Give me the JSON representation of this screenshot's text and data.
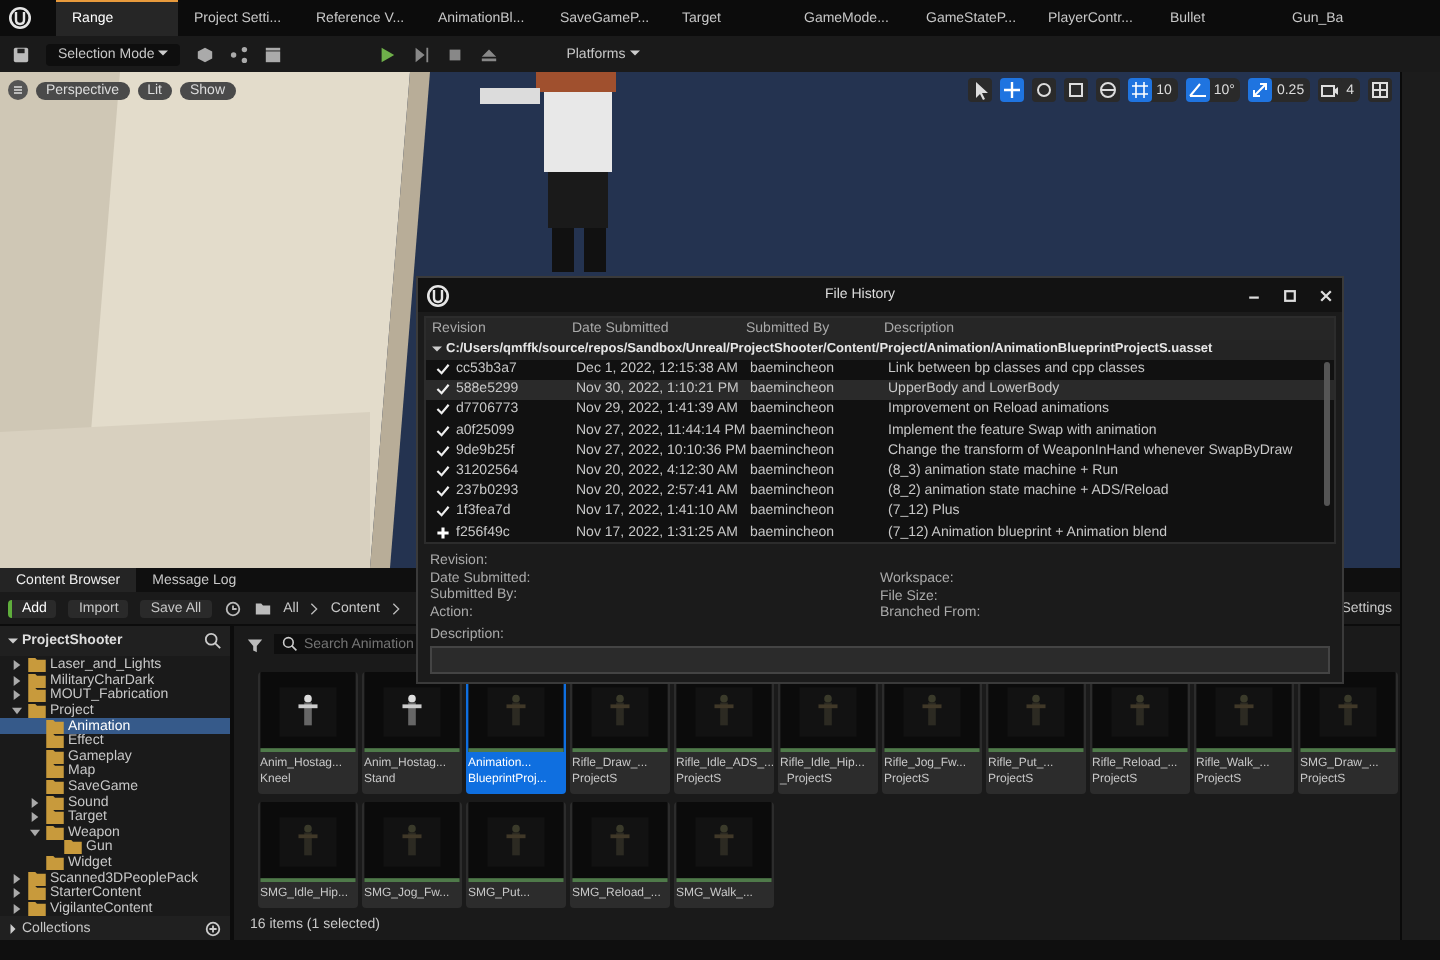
{
  "editor_tabs": [
    {
      "label": "Range",
      "selected": true
    },
    {
      "label": "Project Setti...",
      "selected": false
    },
    {
      "label": "Reference V...",
      "selected": false
    },
    {
      "label": "AnimationBl...",
      "selected": false
    },
    {
      "label": "SaveGameP...",
      "selected": false
    },
    {
      "label": "Target",
      "selected": false
    },
    {
      "label": "GameMode...",
      "selected": false
    },
    {
      "label": "GameStateP...",
      "selected": false
    },
    {
      "label": "PlayerContr...",
      "selected": false
    },
    {
      "label": "Bullet",
      "selected": false
    },
    {
      "label": "Gun_Ba",
      "selected": false
    }
  ],
  "toolbar": {
    "mode": "Selection Mode",
    "platforms": "Platforms"
  },
  "viewport": {
    "view_buttons": [
      "Perspective",
      "Lit",
      "Show"
    ],
    "grid_snap": "10",
    "rotation_snap": "10°",
    "scale_snap": "0.25",
    "camera_speed": "4"
  },
  "file_history": {
    "title": "File History",
    "columns": [
      "Revision",
      "Date Submitted",
      "Submitted By",
      "Description"
    ],
    "path": "C:/Users/qmffk/source/repos/Sandbox/Unreal/ProjectShooter/Content/Project/Animation/AnimationBlueprintProjectS.uasset",
    "revisions": [
      {
        "kind": "check",
        "revision": "cc53b3a7",
        "date": "Dec 1, 2022, 12:15:38 AM",
        "submitted_by": "baemincheon",
        "description": "Link between bp classes and cpp classes",
        "selected": false
      },
      {
        "kind": "check",
        "revision": "588e5299",
        "date": "Nov 30, 2022, 1:10:21 PM",
        "submitted_by": "baemincheon",
        "description": "UpperBody and LowerBody",
        "selected": true
      },
      {
        "kind": "check",
        "revision": "d7706773",
        "date": "Nov 29, 2022, 1:41:39 AM",
        "submitted_by": "baemincheon",
        "description": "Improvement on Reload animations",
        "selected": false
      },
      {
        "kind": "check",
        "revision": "a0f25099",
        "date": "Nov 27, 2022, 11:44:14 PM",
        "submitted_by": "baemincheon",
        "description": "Implement the feature Swap with animation",
        "selected": false
      },
      {
        "kind": "check",
        "revision": "9de9b25f",
        "date": "Nov 27, 2022, 10:10:36 PM",
        "submitted_by": "baemincheon",
        "description": "Change the transform of WeaponInHand whenever SwapByDraw",
        "selected": false
      },
      {
        "kind": "check",
        "revision": "31202564",
        "date": "Nov 20, 2022, 4:12:30 AM",
        "submitted_by": "baemincheon",
        "description": "(8_3) animation state machine + Run",
        "selected": false
      },
      {
        "kind": "check",
        "revision": "237b0293",
        "date": "Nov 20, 2022, 2:57:41 AM",
        "submitted_by": "baemincheon",
        "description": "(8_2) animation state machine + ADS/Reload",
        "selected": false
      },
      {
        "kind": "check",
        "revision": "1f3fea7d",
        "date": "Nov 17, 2022, 1:41:10 AM",
        "submitted_by": "baemincheon",
        "description": "(7_12) Plus",
        "selected": false
      },
      {
        "kind": "add",
        "revision": "f256f49c",
        "date": "Nov 17, 2022, 1:31:25 AM",
        "submitted_by": "baemincheon",
        "description": "(7_12) Animation blueprint + Animation blend",
        "selected": false
      }
    ],
    "details_left": [
      "Revision:",
      "Date Submitted:",
      "Submitted By:",
      "Action:"
    ],
    "details_right": [
      "Workspace:",
      "File Size:",
      "Branched From:"
    ],
    "description_label": "Description:"
  },
  "content_browser": {
    "tabs": [
      {
        "label": "Content Browser",
        "selected": true
      },
      {
        "label": "Message Log",
        "selected": false
      }
    ],
    "actions": [
      "Add",
      "Import",
      "Save All"
    ],
    "breadcrumb": [
      "All",
      "Content"
    ],
    "settings": "Settings",
    "tree_root": "ProjectShooter",
    "folders": [
      {
        "name": "Laser_and_Lights",
        "expanded": false,
        "selected": false
      },
      {
        "name": "MilitaryCharDark",
        "expanded": false,
        "selected": false
      },
      {
        "name": "MOUT_Fabrication",
        "expanded": false,
        "selected": false
      },
      {
        "name": "Project",
        "expanded": true,
        "selected": false,
        "children": [
          {
            "name": "Animation",
            "selected": true
          },
          {
            "name": "Effect",
            "selected": false
          },
          {
            "name": "Gameplay",
            "selected": false
          },
          {
            "name": "Map",
            "selected": false
          },
          {
            "name": "SaveGame",
            "selected": false
          },
          {
            "name": "Sound",
            "expanded": false,
            "selected": false
          },
          {
            "name": "Target",
            "expanded": false,
            "selected": false
          },
          {
            "name": "Weapon",
            "expanded": true,
            "selected": false,
            "children": [
              {
                "name": "Gun",
                "selected": false
              }
            ]
          },
          {
            "name": "Widget",
            "selected": false
          }
        ]
      },
      {
        "name": "Scanned3DPeoplePack",
        "expanded": false,
        "selected": false
      },
      {
        "name": "StarterContent",
        "expanded": false,
        "selected": false
      },
      {
        "name": "VigilanteContent",
        "expanded": false,
        "selected": false
      }
    ],
    "collections": "Collections",
    "search": {
      "placeholder": "Search Animation"
    },
    "assets": [
      {
        "name": "Anim_Hostag...",
        "subtitle": "Kneel",
        "selected": false
      },
      {
        "name": "Anim_Hostag...",
        "subtitle": "Stand",
        "selected": false
      },
      {
        "name": "Animation...",
        "subtitle": "BlueprintProj...",
        "selected": true
      },
      {
        "name": "Rifle_Draw_...",
        "subtitle": "ProjectS",
        "selected": false
      },
      {
        "name": "Rifle_Idle_ADS_...",
        "subtitle": "ProjectS",
        "selected": false
      },
      {
        "name": "Rifle_Idle_Hip...",
        "subtitle": "_ProjectS",
        "selected": false
      },
      {
        "name": "Rifle_Jog_Fw...",
        "subtitle": "ProjectS",
        "selected": false
      },
      {
        "name": "Rifle_Put_...",
        "subtitle": "ProjectS",
        "selected": false
      },
      {
        "name": "Rifle_Reload_...",
        "subtitle": "ProjectS",
        "selected": false
      },
      {
        "name": "Rifle_Walk_...",
        "subtitle": "ProjectS",
        "selected": false
      },
      {
        "name": "SMG_Draw_...",
        "subtitle": "ProjectS",
        "selected": false
      },
      {
        "name": "SMG_Idle_Hip...",
        "selected": false
      },
      {
        "name": "SMG_Jog_Fw...",
        "selected": false
      },
      {
        "name": "SMG_Put...",
        "selected": false
      },
      {
        "name": "SMG_Reload_...",
        "selected": false
      },
      {
        "name": "SMG_Walk_...",
        "selected": false
      }
    ],
    "status": "16 items (1 selected)"
  }
}
